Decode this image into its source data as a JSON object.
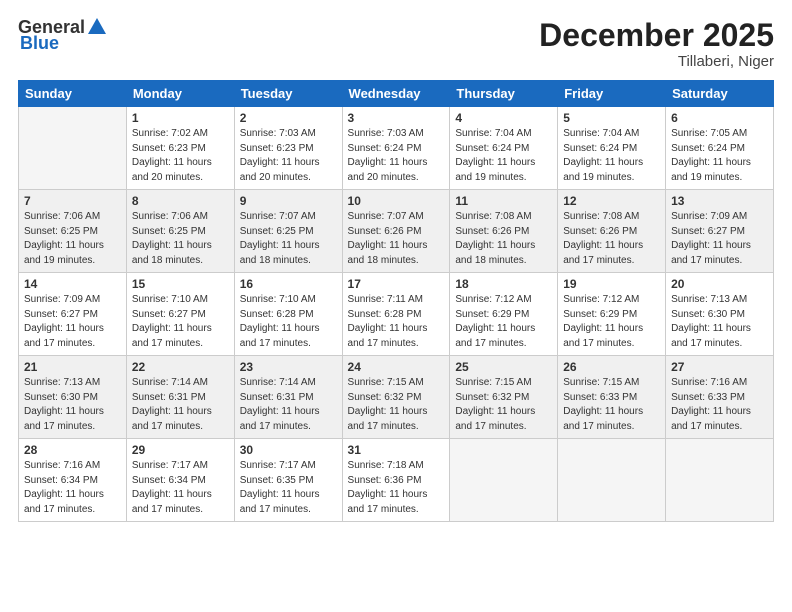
{
  "header": {
    "logo_general": "General",
    "logo_blue": "Blue",
    "month_title": "December 2025",
    "location": "Tillaberi, Niger"
  },
  "weekdays": [
    "Sunday",
    "Monday",
    "Tuesday",
    "Wednesday",
    "Thursday",
    "Friday",
    "Saturday"
  ],
  "weeks": [
    [
      {
        "day": "",
        "info": ""
      },
      {
        "day": "1",
        "info": "Sunrise: 7:02 AM\nSunset: 6:23 PM\nDaylight: 11 hours\nand 20 minutes."
      },
      {
        "day": "2",
        "info": "Sunrise: 7:03 AM\nSunset: 6:23 PM\nDaylight: 11 hours\nand 20 minutes."
      },
      {
        "day": "3",
        "info": "Sunrise: 7:03 AM\nSunset: 6:24 PM\nDaylight: 11 hours\nand 20 minutes."
      },
      {
        "day": "4",
        "info": "Sunrise: 7:04 AM\nSunset: 6:24 PM\nDaylight: 11 hours\nand 19 minutes."
      },
      {
        "day": "5",
        "info": "Sunrise: 7:04 AM\nSunset: 6:24 PM\nDaylight: 11 hours\nand 19 minutes."
      },
      {
        "day": "6",
        "info": "Sunrise: 7:05 AM\nSunset: 6:24 PM\nDaylight: 11 hours\nand 19 minutes."
      }
    ],
    [
      {
        "day": "7",
        "info": "Sunrise: 7:06 AM\nSunset: 6:25 PM\nDaylight: 11 hours\nand 19 minutes."
      },
      {
        "day": "8",
        "info": "Sunrise: 7:06 AM\nSunset: 6:25 PM\nDaylight: 11 hours\nand 18 minutes."
      },
      {
        "day": "9",
        "info": "Sunrise: 7:07 AM\nSunset: 6:25 PM\nDaylight: 11 hours\nand 18 minutes."
      },
      {
        "day": "10",
        "info": "Sunrise: 7:07 AM\nSunset: 6:26 PM\nDaylight: 11 hours\nand 18 minutes."
      },
      {
        "day": "11",
        "info": "Sunrise: 7:08 AM\nSunset: 6:26 PM\nDaylight: 11 hours\nand 18 minutes."
      },
      {
        "day": "12",
        "info": "Sunrise: 7:08 AM\nSunset: 6:26 PM\nDaylight: 11 hours\nand 17 minutes."
      },
      {
        "day": "13",
        "info": "Sunrise: 7:09 AM\nSunset: 6:27 PM\nDaylight: 11 hours\nand 17 minutes."
      }
    ],
    [
      {
        "day": "14",
        "info": "Sunrise: 7:09 AM\nSunset: 6:27 PM\nDaylight: 11 hours\nand 17 minutes."
      },
      {
        "day": "15",
        "info": "Sunrise: 7:10 AM\nSunset: 6:27 PM\nDaylight: 11 hours\nand 17 minutes."
      },
      {
        "day": "16",
        "info": "Sunrise: 7:10 AM\nSunset: 6:28 PM\nDaylight: 11 hours\nand 17 minutes."
      },
      {
        "day": "17",
        "info": "Sunrise: 7:11 AM\nSunset: 6:28 PM\nDaylight: 11 hours\nand 17 minutes."
      },
      {
        "day": "18",
        "info": "Sunrise: 7:12 AM\nSunset: 6:29 PM\nDaylight: 11 hours\nand 17 minutes."
      },
      {
        "day": "19",
        "info": "Sunrise: 7:12 AM\nSunset: 6:29 PM\nDaylight: 11 hours\nand 17 minutes."
      },
      {
        "day": "20",
        "info": "Sunrise: 7:13 AM\nSunset: 6:30 PM\nDaylight: 11 hours\nand 17 minutes."
      }
    ],
    [
      {
        "day": "21",
        "info": "Sunrise: 7:13 AM\nSunset: 6:30 PM\nDaylight: 11 hours\nand 17 minutes."
      },
      {
        "day": "22",
        "info": "Sunrise: 7:14 AM\nSunset: 6:31 PM\nDaylight: 11 hours\nand 17 minutes."
      },
      {
        "day": "23",
        "info": "Sunrise: 7:14 AM\nSunset: 6:31 PM\nDaylight: 11 hours\nand 17 minutes."
      },
      {
        "day": "24",
        "info": "Sunrise: 7:15 AM\nSunset: 6:32 PM\nDaylight: 11 hours\nand 17 minutes."
      },
      {
        "day": "25",
        "info": "Sunrise: 7:15 AM\nSunset: 6:32 PM\nDaylight: 11 hours\nand 17 minutes."
      },
      {
        "day": "26",
        "info": "Sunrise: 7:15 AM\nSunset: 6:33 PM\nDaylight: 11 hours\nand 17 minutes."
      },
      {
        "day": "27",
        "info": "Sunrise: 7:16 AM\nSunset: 6:33 PM\nDaylight: 11 hours\nand 17 minutes."
      }
    ],
    [
      {
        "day": "28",
        "info": "Sunrise: 7:16 AM\nSunset: 6:34 PM\nDaylight: 11 hours\nand 17 minutes."
      },
      {
        "day": "29",
        "info": "Sunrise: 7:17 AM\nSunset: 6:34 PM\nDaylight: 11 hours\nand 17 minutes."
      },
      {
        "day": "30",
        "info": "Sunrise: 7:17 AM\nSunset: 6:35 PM\nDaylight: 11 hours\nand 17 minutes."
      },
      {
        "day": "31",
        "info": "Sunrise: 7:18 AM\nSunset: 6:36 PM\nDaylight: 11 hours\nand 17 minutes."
      },
      {
        "day": "",
        "info": ""
      },
      {
        "day": "",
        "info": ""
      },
      {
        "day": "",
        "info": ""
      }
    ]
  ]
}
